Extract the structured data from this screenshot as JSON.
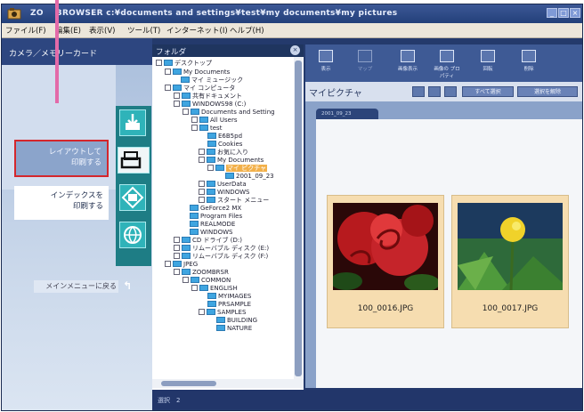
{
  "window": {
    "title": "ZOOMBROWSER c:¥documents and settings¥test¥my documents¥my pictures",
    "title_prefix": "ZO",
    "title_suffix": "BROWSER c:¥documents and settings¥test¥my documents¥my pictures"
  },
  "menu": [
    {
      "label": "ファイル(F)"
    },
    {
      "label": "編集(E)"
    },
    {
      "label": "表示(V)"
    },
    {
      "label": "ツール(T)"
    },
    {
      "label": "インターネット(I)"
    },
    {
      "label": "ヘルプ(H)"
    }
  ],
  "left_panel": {
    "header": "カメラ／メモリーカード",
    "layout_print": {
      "line1": "レイアウトして",
      "line2": "印刷する"
    },
    "index_print": {
      "line1": "インデックスを",
      "line2": "印刷する"
    },
    "main_menu": "メインメニューに戻る"
  },
  "folder_panel": {
    "title": "フォルダ",
    "tree": [
      {
        "label": "デスクトップ",
        "selected": false
      },
      {
        "label": "My Documents",
        "selected": false
      },
      {
        "label": "マイ ミュージック",
        "selected": false
      },
      {
        "label": "マイ コンピュータ",
        "selected": false
      },
      {
        "label": "共有ドキュメント",
        "selected": false
      },
      {
        "label": "WINDOWS98 (C:)",
        "selected": false
      },
      {
        "label": "Documents and Setting",
        "selected": false
      },
      {
        "label": "All Users",
        "selected": false
      },
      {
        "label": "test",
        "selected": false
      },
      {
        "label": "E6B5pd",
        "selected": false
      },
      {
        "label": "Cookies",
        "selected": false
      },
      {
        "label": "お気に入り",
        "selected": false
      },
      {
        "label": "My Documents",
        "selected": false
      },
      {
        "label": "マイ ピクチャ",
        "selected": true
      },
      {
        "label": "2001_09_23",
        "selected": false
      },
      {
        "label": "UserData",
        "selected": false
      },
      {
        "label": "WINDOWS",
        "selected": false
      },
      {
        "label": "スタート メニュー",
        "selected": false
      },
      {
        "label": "GeForce2 MX",
        "selected": false
      },
      {
        "label": "Program Files",
        "selected": false
      },
      {
        "label": "REALMODE",
        "selected": false
      },
      {
        "label": "WINDOWS",
        "selected": false
      },
      {
        "label": "CD ドライブ (D:)",
        "selected": false
      },
      {
        "label": "リムーバブル ディスク (E:)",
        "selected": false
      },
      {
        "label": "リムーバブル ディスク (F:)",
        "selected": false
      },
      {
        "label": "JPEG",
        "selected": false
      },
      {
        "label": "ZOOMBRSR",
        "selected": false
      },
      {
        "label": "COMMON",
        "selected": false
      },
      {
        "label": "ENGLISH",
        "selected": false
      },
      {
        "label": "MYIMAGES",
        "selected": false
      },
      {
        "label": "PRSAMPLE",
        "selected": false
      },
      {
        "label": "SAMPLES",
        "selected": false
      },
      {
        "label": "BUILDING",
        "selected": false
      },
      {
        "label": "NATURE",
        "selected": false
      }
    ]
  },
  "toolbar": [
    {
      "label": "表示",
      "enabled": true
    },
    {
      "label": "マップ",
      "enabled": false
    },
    {
      "label": "画像表示",
      "enabled": true
    },
    {
      "label": "画像の プロパティ",
      "enabled": true
    },
    {
      "label": "回転",
      "enabled": true
    },
    {
      "label": "削除",
      "enabled": true
    }
  ],
  "path_bar": {
    "title": "マイピクチャ",
    "select_all": "すべて選択",
    "clear_selection": "選択を解除"
  },
  "gallery": {
    "tab_label": "2001_09_23",
    "thumbnails": [
      {
        "caption": "100_0016.JPG"
      },
      {
        "caption": "100_0017.JPG"
      }
    ]
  },
  "status": {
    "text": "選択　2"
  },
  "colors": {
    "highlight_border": "#d4262c",
    "selected_folder": "#f2b04a",
    "window_frame": "#243a6c",
    "accent_teal": "#2fb3b9"
  }
}
